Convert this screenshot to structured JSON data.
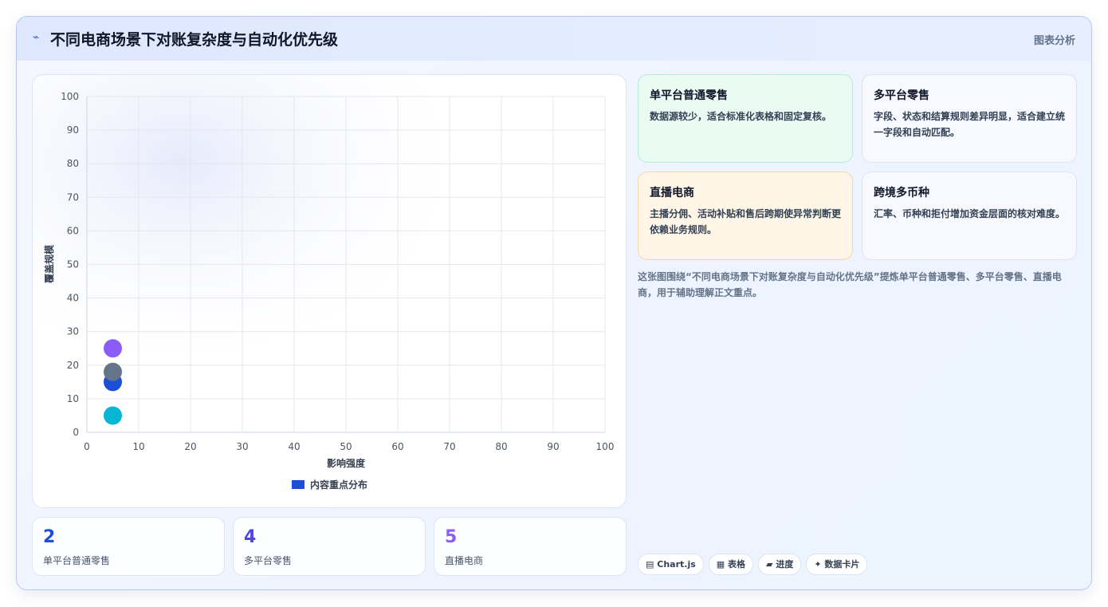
{
  "header": {
    "title": "不同电商场景下对账复杂度与自动化优先级",
    "tag": "图表分析",
    "logo_icon": "lightning-icon"
  },
  "chart_data": {
    "type": "scatter",
    "xlabel": "影响强度",
    "ylabel": "覆盖规模",
    "xlim": [
      0,
      100
    ],
    "ylim": [
      0,
      100
    ],
    "xticks": [
      0,
      10,
      20,
      30,
      40,
      50,
      60,
      70,
      80,
      90,
      100
    ],
    "yticks": [
      0,
      10,
      20,
      30,
      40,
      50,
      60,
      70,
      80,
      90,
      100
    ],
    "grid": true,
    "legend_position": "bottom",
    "legend": [
      "内容重点分布"
    ],
    "points": [
      {
        "x": 5,
        "y": 15,
        "color": "#1d4ed8"
      },
      {
        "x": 5,
        "y": 25,
        "color": "#8b5cf6"
      },
      {
        "x": 5,
        "y": 18,
        "color": "#64748b"
      },
      {
        "x": 5,
        "y": 5,
        "color": "#06b6d4"
      }
    ],
    "legend_color": "#1d4ed8"
  },
  "stats": [
    {
      "value": "2",
      "label": "单平台普通零售",
      "color": "#1d4ed8"
    },
    {
      "value": "4",
      "label": "多平台零售",
      "color": "#4f46e5"
    },
    {
      "value": "5",
      "label": "直播电商",
      "color": "#8b5cf6"
    }
  ],
  "cards": [
    {
      "title": "单平台普通零售",
      "desc": "数据源较少，适合标准化表格和固定复核。"
    },
    {
      "title": "多平台零售",
      "desc": "字段、状态和结算规则差异明显，适合建立统一字段和自动匹配。"
    },
    {
      "title": "直播电商",
      "desc": "主播分佣、活动补贴和售后跨期使异常判断更依赖业务规则。"
    },
    {
      "title": "跨境多币种",
      "desc": "汇率、币种和拒付增加资金层面的核对难度。"
    }
  ],
  "caption": "这张图围绕“不同电商场景下对账复杂度与自动化优先级”提炼单平台普通零售、多平台零售、直播电商，用于辅助理解正文重点。",
  "chips": [
    {
      "icon": "chart-icon",
      "glyph": "▤",
      "label": "Chart.js"
    },
    {
      "icon": "table-icon",
      "glyph": "▦",
      "label": "表格"
    },
    {
      "icon": "progress-icon",
      "glyph": "▰",
      "label": "进度"
    },
    {
      "icon": "sparkle-icon",
      "glyph": "✦",
      "label": "数据卡片"
    }
  ]
}
